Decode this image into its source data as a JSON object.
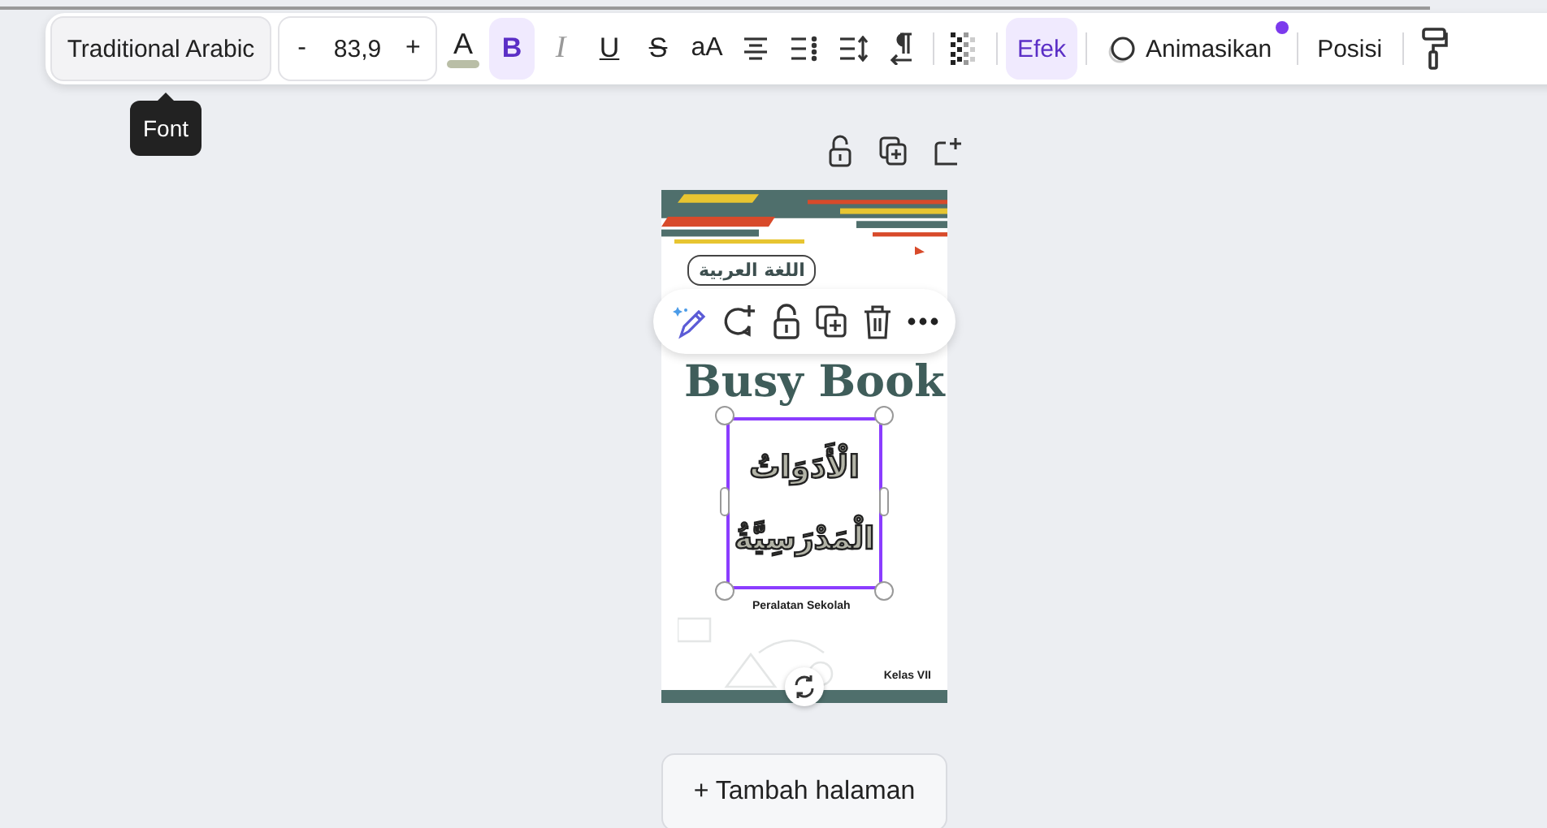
{
  "toolbar": {
    "font": "Traditional Arabic",
    "font_size": {
      "decrease": "-",
      "value": "83,9",
      "increase": "+"
    },
    "text_color": {
      "letter": "A",
      "color": "#b9bea6"
    },
    "format_buttons": [
      {
        "kind": "bold",
        "label": "B",
        "on": true
      },
      {
        "kind": "italic",
        "label": "I",
        "on": false
      },
      {
        "kind": "underline",
        "label": "U",
        "on": false
      },
      {
        "kind": "strike",
        "label": "S",
        "on": false
      },
      {
        "kind": "case",
        "label": "aA",
        "on": false
      }
    ],
    "effects": {
      "label": "Efek",
      "selected": true
    },
    "animate": {
      "label": "Animasikan",
      "new_badge": true
    },
    "position": {
      "label": "Posisi"
    }
  },
  "tooltip": "Font",
  "cover": {
    "badge": "اللغة العربية",
    "title": "Busy Book",
    "arabic_title": "الْأَدَوَاتُ الْمَدْرَسِيَّةُ",
    "subtitle": "Peralatan Sekolah",
    "grade": "Kelas VII",
    "element_selected": true
  },
  "add_page": "+ Tambah halaman"
}
